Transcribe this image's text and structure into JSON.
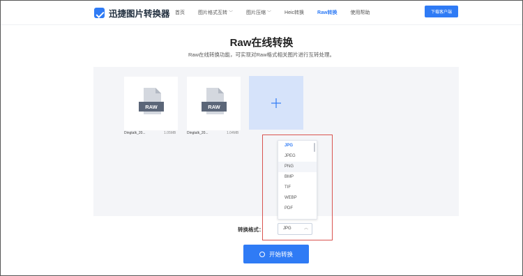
{
  "header": {
    "logo_text": "迅捷图片转换器",
    "nav": [
      {
        "label": "首页",
        "has_dropdown": false,
        "active": false
      },
      {
        "label": "图片格式互转",
        "has_dropdown": true,
        "active": false
      },
      {
        "label": "图片压缩",
        "has_dropdown": true,
        "active": false
      },
      {
        "label": "Heic转换",
        "has_dropdown": false,
        "active": false
      },
      {
        "label": "Raw转换",
        "has_dropdown": false,
        "active": true
      },
      {
        "label": "使用帮助",
        "has_dropdown": false,
        "active": false
      }
    ],
    "download_label": "下载客户端"
  },
  "main": {
    "title": "Raw在线转换",
    "subtitle": "Raw在线转换功能，可实现对Raw格式相关图片进行互转处理。"
  },
  "files": [
    {
      "name": "Dingtalk_20...",
      "size": "1.05MB",
      "badge": "RAW"
    },
    {
      "name": "Dingtalk_20...",
      "size": "1.04MB",
      "badge": "RAW"
    }
  ],
  "add_symbol": "+",
  "format": {
    "label": "转换格式：",
    "selected": "JPG",
    "options": [
      "JPG",
      "JPEG",
      "PNG",
      "BMP",
      "TIF",
      "WEBP",
      "PDF"
    ]
  },
  "start_label": "开始转换",
  "colors": {
    "accent": "#2f7bf5",
    "highlight": "#d9534f",
    "upload_bg": "#f4f5f8",
    "add_bg": "#d6e3fa"
  }
}
